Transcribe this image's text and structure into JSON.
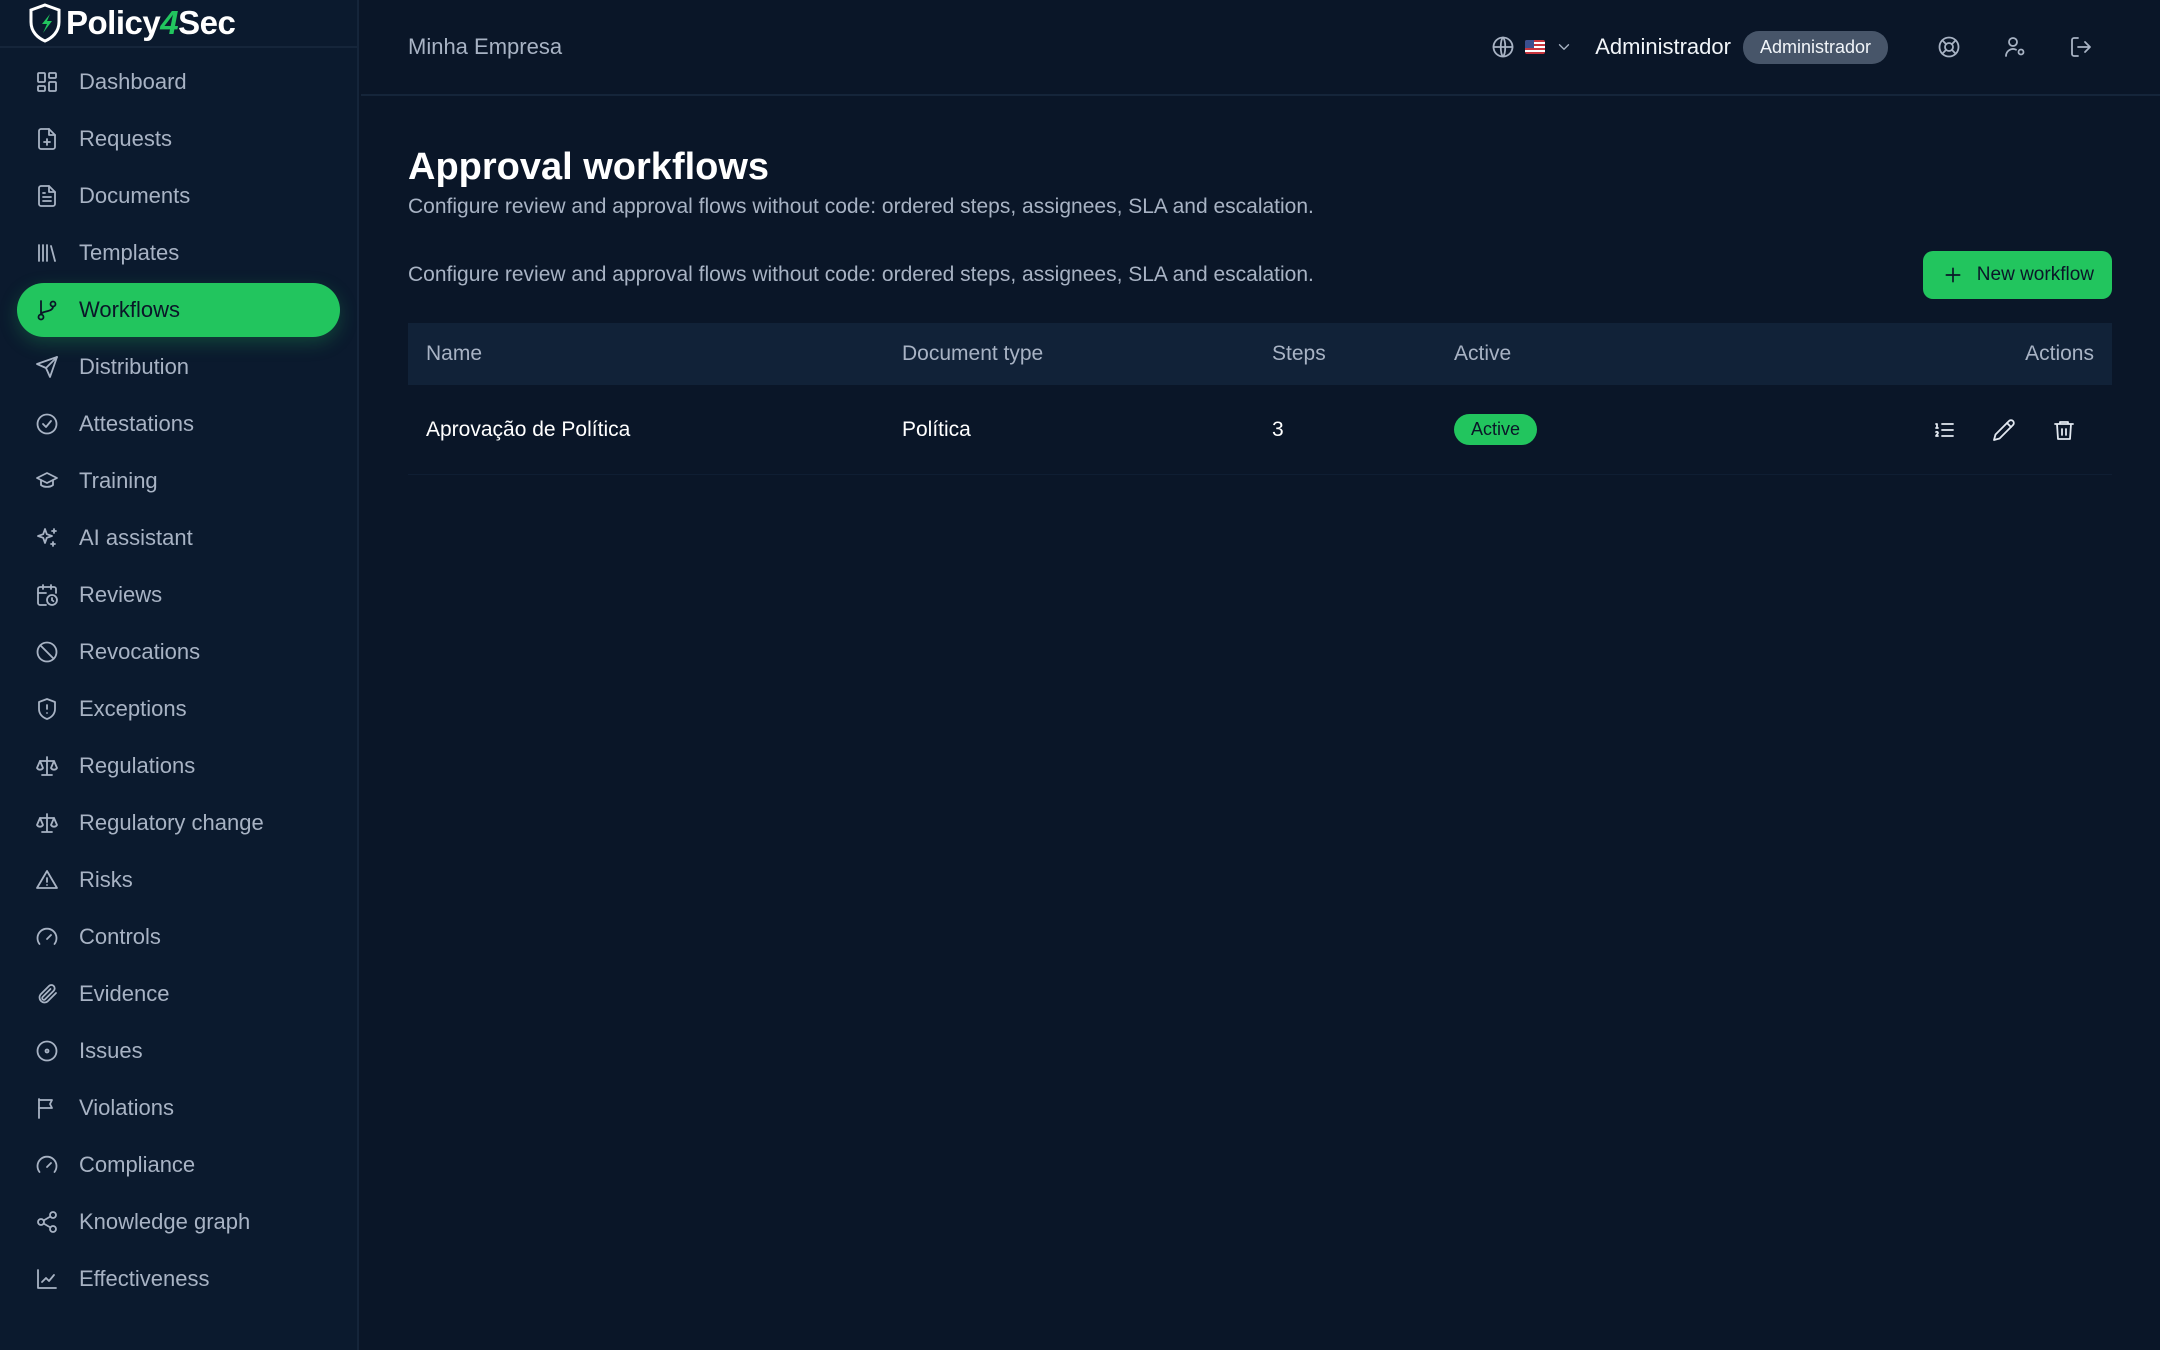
{
  "brand": {
    "name_part1": "Policy",
    "name_part2": "4",
    "name_part3": "Sec"
  },
  "sidebar": {
    "items": [
      {
        "label": "Dashboard",
        "icon": "dashboard-icon"
      },
      {
        "label": "Requests",
        "icon": "file-plus-icon"
      },
      {
        "label": "Documents",
        "icon": "document-icon"
      },
      {
        "label": "Templates",
        "icon": "library-icon"
      },
      {
        "label": "Workflows",
        "icon": "git-branch-icon",
        "active": true
      },
      {
        "label": "Distribution",
        "icon": "send-icon"
      },
      {
        "label": "Attestations",
        "icon": "check-circle-icon"
      },
      {
        "label": "Training",
        "icon": "graduation-cap-icon"
      },
      {
        "label": "AI assistant",
        "icon": "sparkles-icon"
      },
      {
        "label": "Reviews",
        "icon": "calendar-clock-icon"
      },
      {
        "label": "Revocations",
        "icon": "ban-icon"
      },
      {
        "label": "Exceptions",
        "icon": "shield-alert-icon"
      },
      {
        "label": "Regulations",
        "icon": "scale-icon"
      },
      {
        "label": "Regulatory change",
        "icon": "scale-icon"
      },
      {
        "label": "Risks",
        "icon": "alert-triangle-icon"
      },
      {
        "label": "Controls",
        "icon": "gauge-icon"
      },
      {
        "label": "Evidence",
        "icon": "paperclip-icon"
      },
      {
        "label": "Issues",
        "icon": "circle-dot-icon"
      },
      {
        "label": "Violations",
        "icon": "flag-icon"
      },
      {
        "label": "Compliance",
        "icon": "gauge-icon"
      },
      {
        "label": "Knowledge graph",
        "icon": "share-icon"
      },
      {
        "label": "Effectiveness",
        "icon": "chart-icon"
      }
    ]
  },
  "header": {
    "company": "Minha Empresa",
    "user_name": "Administrador",
    "role": "Administrador"
  },
  "main": {
    "title": "Approval workflows",
    "subtitle": "Configure review and approval flows without code: ordered steps, assignees, SLA and escalation.",
    "toolbar_desc": "Configure review and approval flows without code: ordered steps, assignees, SLA and escalation.",
    "new_button": "New workflow"
  },
  "table": {
    "columns": [
      "Name",
      "Document type",
      "Steps",
      "Active",
      "Actions"
    ],
    "rows": [
      {
        "name": "Aprovação de Política",
        "doc_type": "Política",
        "steps": "3",
        "active": "Active"
      }
    ]
  },
  "colors": {
    "accent": "#22c55e",
    "background": "#0a1628",
    "sidebar": "#0b1a2e"
  }
}
